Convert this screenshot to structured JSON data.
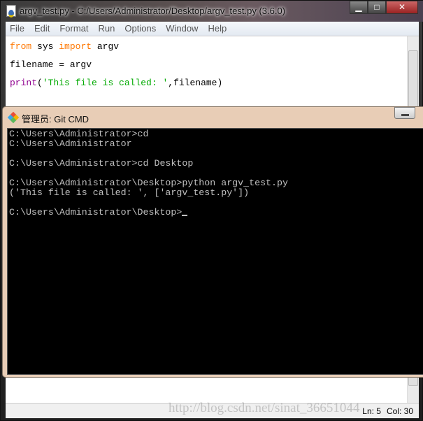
{
  "idle": {
    "title": "argv_test.py - C:/Users/Administrator/Desktop/argv_test.py (3.6.0)",
    "menu": [
      "File",
      "Edit",
      "Format",
      "Run",
      "Options",
      "Window",
      "Help"
    ],
    "code": {
      "line1": {
        "kw1": "from",
        "mid": " sys ",
        "kw2": "import",
        "rest": " argv"
      },
      "line3": "filename = argv",
      "line5": {
        "builtin": "print",
        "open": "(",
        "str": "'This file is called: '",
        "rest": ",filename)"
      }
    },
    "status": {
      "ln": "Ln: 5",
      "col": "Col: 30"
    },
    "watermark": "http://blog.csdn.net/sinat_36651044"
  },
  "git": {
    "title": "管理员: Git CMD",
    "lines": [
      "C:\\Users\\Administrator>cd",
      "C:\\Users\\Administrator",
      "",
      "C:\\Users\\Administrator>cd Desktop",
      "",
      "C:\\Users\\Administrator\\Desktop>python argv_test.py",
      "('This file is called: ', ['argv_test.py'])",
      "",
      "C:\\Users\\Administrator\\Desktop>"
    ]
  },
  "colors": {
    "keyword": "#ff7700",
    "builtin": "#900090",
    "string": "#00aa00",
    "console_bg": "#000000",
    "console_fg": "#c0c0c0"
  }
}
